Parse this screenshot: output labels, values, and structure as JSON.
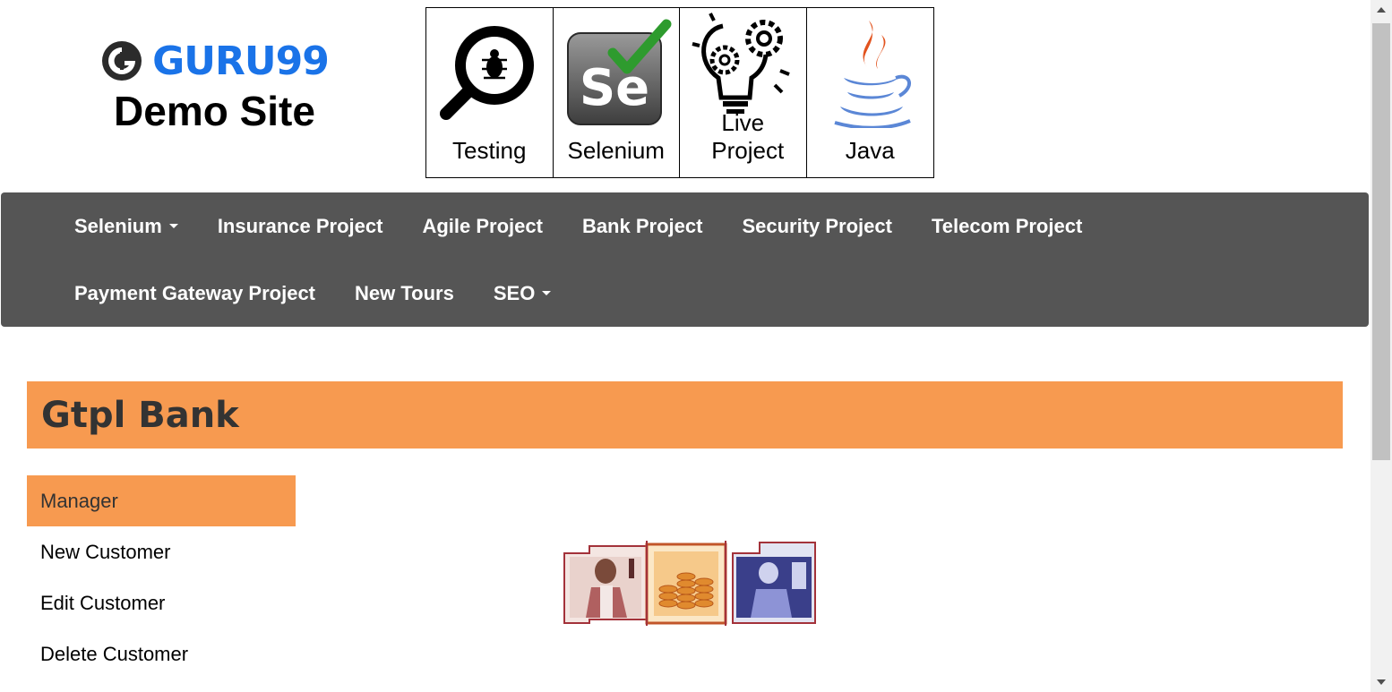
{
  "header": {
    "brand_name": "GURU99",
    "brand_sub": "Demo Site",
    "tiles": [
      {
        "label": "Testing",
        "icon": "magnifier-bug-icon"
      },
      {
        "label": "Selenium",
        "icon": "selenium-logo-icon"
      },
      {
        "label": "Live Project",
        "icon": "lightbulb-gears-icon"
      },
      {
        "label": "Java",
        "icon": "java-logo-icon"
      }
    ]
  },
  "navbar": {
    "items": [
      {
        "label": "Selenium",
        "dropdown": true
      },
      {
        "label": "Insurance Project"
      },
      {
        "label": "Agile Project"
      },
      {
        "label": "Bank Project"
      },
      {
        "label": "Security Project"
      },
      {
        "label": "Telecom Project"
      },
      {
        "label": "Payment Gateway Project"
      },
      {
        "label": "New Tours"
      },
      {
        "label": "SEO",
        "dropdown": true
      }
    ]
  },
  "page": {
    "title": "Gtpl Bank"
  },
  "side_menu": {
    "items": [
      {
        "label": "Manager",
        "active": true
      },
      {
        "label": "New Customer"
      },
      {
        "label": "Edit Customer"
      },
      {
        "label": "Delete Customer"
      }
    ]
  },
  "colors": {
    "accent": "#f79a50",
    "navbar": "#555555",
    "brand": "#1a73e8"
  }
}
